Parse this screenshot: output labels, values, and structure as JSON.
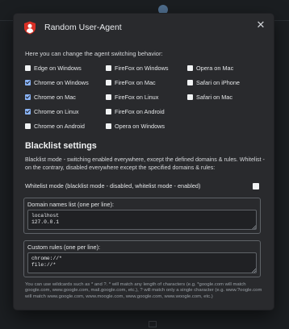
{
  "modal": {
    "title": "Random User-Agent",
    "close_symbol": "✕",
    "intro": "Here you can change the agent switching behavior:"
  },
  "agents": [
    {
      "label": "Edge on Windows",
      "checked": false
    },
    {
      "label": "FireFox on Windows",
      "checked": false
    },
    {
      "label": "Opera on Mac",
      "checked": false
    },
    {
      "label": "Chrome on Windows",
      "checked": true
    },
    {
      "label": "FireFox on Mac",
      "checked": false
    },
    {
      "label": "Safari on iPhone",
      "checked": false
    },
    {
      "label": "Chrome on Mac",
      "checked": true
    },
    {
      "label": "FireFox on Linux",
      "checked": false
    },
    {
      "label": "Safari on Mac",
      "checked": false
    },
    {
      "label": "Chrome on Linux",
      "checked": true
    },
    {
      "label": "FireFox on Android",
      "checked": false
    },
    {
      "label": "Chrome on Android",
      "checked": false
    },
    {
      "label": "Opera on Windows",
      "checked": false
    }
  ],
  "blacklist": {
    "title": "Blacklist settings",
    "description": "Blacklist mode - switching enabled everywhere, except the defined domains & rules. Whitelist - on the contrary, disabled everywhere except the specified domains & rules:",
    "whitelist_label": "Whitelist mode (blacklist mode - disabled, whitelist mode - enabled)",
    "whitelist_checked": false,
    "domains_label": "Domain names list (one per line):",
    "domains_value": "localhost\n127.0.0.1",
    "rules_label": "Custom rules (one per line):",
    "rules_value": "chrome://*\nfile://*",
    "hint": "You can use wildcards such as * and ?. * will match any length of characters (e.g. *google.com will match google.com, www.google.com, mail.google.com, etc.), ? will match only a single character (e.g. www.?oogle.com will match www.google.com, www.moogle.com, www.google.com, www.woogle.com, etc.)"
  },
  "colors": {
    "accent": "#8ab4f8",
    "logo_red": "#d93025",
    "modal_bg": "#292a2d",
    "page_bg": "#16191c"
  }
}
